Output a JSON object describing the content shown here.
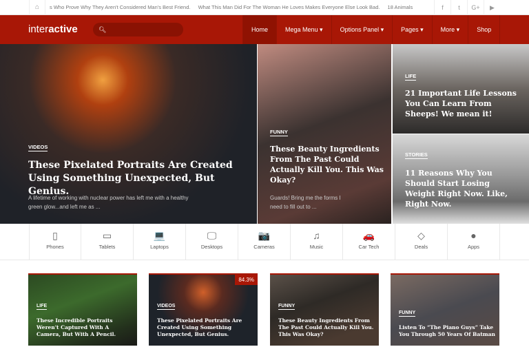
{
  "topbar": {
    "ticker": [
      "s Who Prove Why They Aren't Considered Man's Best Friend.",
      "What This Man Did For The Woman He Loves Makes Everyone Else Look Bad.",
      "18 Animals"
    ],
    "social": [
      "facebook-icon",
      "twitter-icon",
      "google-plus-icon",
      "youtube-icon"
    ],
    "social_glyphs": [
      "f",
      "t",
      "G+",
      "▶"
    ]
  },
  "nav": {
    "logo_light": "inter",
    "logo_bold": "active",
    "menu": [
      "Home",
      "Mega Menu ▾",
      "Options Panel ▾",
      "Pages ▾",
      "More ▾",
      "Shop"
    ],
    "accent": "#a81706"
  },
  "hero": {
    "main": {
      "category": "VIDEOS",
      "title": "These Pixelated Portraits Are Created Using Something Unexpected, But Genius.",
      "excerpt": "A lifetime of working with nuclear power has left me with a healthy green glow...and left me as ..."
    },
    "middle": {
      "category": "FUNNY",
      "title": "These Beauty Ingredients From The Past Could Actually Kill You. This Was Okay?",
      "excerpt": "Guards! Bring me the forms I need to fill out to ..."
    },
    "top_right": {
      "category": "LIFE",
      "title": "21 Important Life Lessons You Can Learn From Sheeps! We mean it!"
    },
    "bottom_right": {
      "category": "STORIES",
      "title": "11 Reasons Why You Should Start Losing Weight Right Now. Like, Right Now."
    }
  },
  "categories": [
    {
      "label": "Phones",
      "icon": "▯"
    },
    {
      "label": "Tablets",
      "icon": "▭"
    },
    {
      "label": "Laptops",
      "icon": "💻"
    },
    {
      "label": "Desktops",
      "icon": "🖵"
    },
    {
      "label": "Cameras",
      "icon": "📷"
    },
    {
      "label": "Music",
      "icon": "♫"
    },
    {
      "label": "Car Tech",
      "icon": "🚗"
    },
    {
      "label": "Deals",
      "icon": "◇"
    },
    {
      "label": "Apps",
      "icon": ""
    }
  ],
  "cards": [
    {
      "category": "LIFE",
      "title": "These Incredible Portraits Weren't Captured With A Camera, But With A Pencil."
    },
    {
      "category": "VIDEOS",
      "title": "These Pixelated Portraits Are Created Using Something Unexpected, But Genius.",
      "badge": "84.3%"
    },
    {
      "category": "FUNNY",
      "title": "These Beauty Ingredients From The Past Could Actually Kill You. This Was Okay?"
    },
    {
      "category": "FUNNY",
      "title": "Listen To “The Piano Guys” Take You Through 50 Years Of Batman"
    }
  ]
}
